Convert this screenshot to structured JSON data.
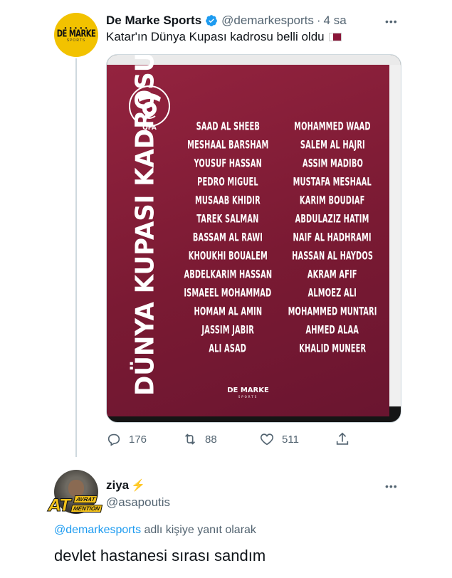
{
  "tweet": {
    "author_name": "De Marke Sports",
    "author_handle": "@demarkesports",
    "separator": "·",
    "time": "4 sa",
    "text": "Katar'ın Dünya Kupası kadrosu belli oldu",
    "avatar": {
      "top_text": "● ● ● ● ●",
      "brand": "DE MARKE",
      "sub": "SPORTS"
    },
    "verified_color": "#1d9bf0",
    "flag_icon": "qatar-flag",
    "media": {
      "crest_text": "QFA",
      "vertical_title": "DÜNYA KUPASI KADROSU",
      "left_column": [
        "SAAD AL SHEEB",
        "MESHAAL BARSHAM",
        "YOUSUF HASSAN",
        "PEDRO MIGUEL",
        "MUSAAB KHIDIR",
        "TAREK SALMAN",
        "BASSAM AL RAWI",
        "KHOUKHI BOUALEM",
        "ABDELKARIM HASSAN",
        "ISMAEEL MOHAMMAD",
        "HOMAM AL AMIN",
        "JASSIM JABIR",
        "ALI ASAD"
      ],
      "right_column": [
        "MOHAMMED WAAD",
        "SALEM AL HAJRI",
        "ASSIM MADIBO",
        "MUSTAFA MESHAAL",
        "KARIM BOUDIAF",
        "ABDULAZIZ HATIM",
        "NAIF AL HADHRAMI",
        "HASSAN AL HAYDOS",
        "AKRAM AFIF",
        "ALMOEZ ALI",
        "MOHAMMED MUNTARI",
        "AHMED ALAA",
        "KHALID MUNEER"
      ],
      "logo_text": "DE MARKE",
      "logo_sub": "SPORTS",
      "poster_color": "#8a1538"
    },
    "actions": {
      "replies": "176",
      "retweets": "88",
      "likes": "511"
    }
  },
  "reply": {
    "author_name": "ziya",
    "author_handle": "@asapoutis",
    "badge_at": "AT",
    "badge_t1": "AVRAT",
    "badge_t2": "MENTION",
    "reply_to_mention": "@demarkesports",
    "reply_to_suffix": " adlı kişiye yanıt olarak",
    "text": "devlet hastanesi sırası sandım"
  },
  "colors": {
    "secondary_text": "#536471",
    "link": "#1d9bf0",
    "thread_line": "#cfd9de"
  }
}
